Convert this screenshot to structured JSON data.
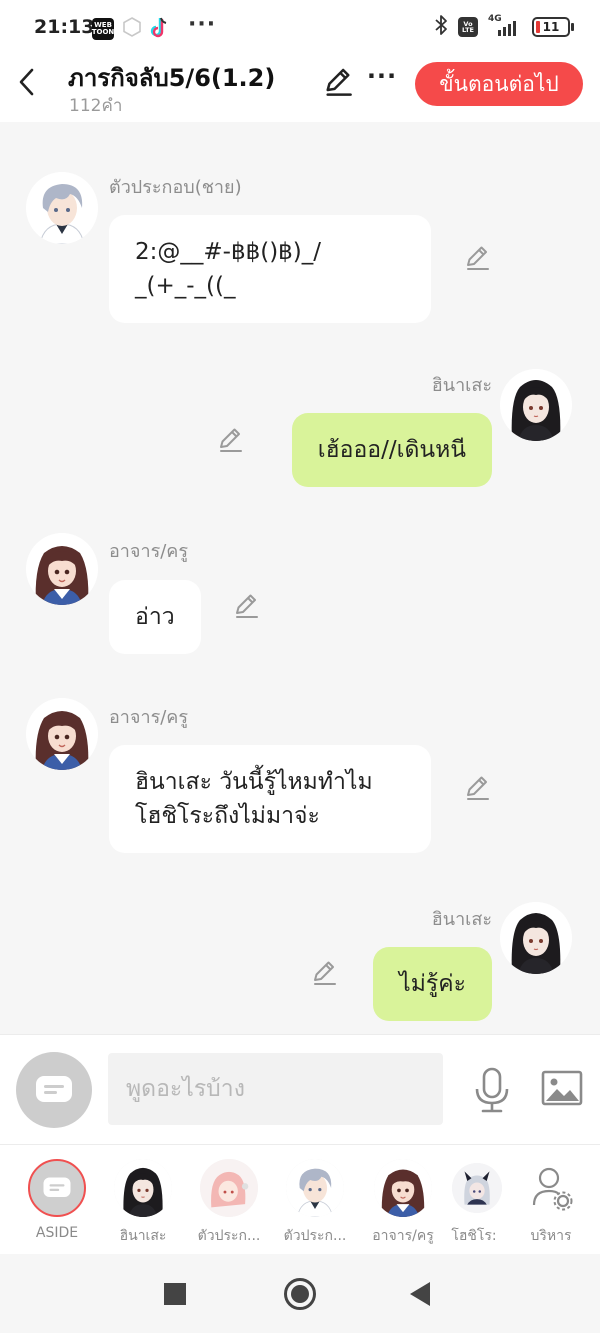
{
  "status_bar": {
    "time": "21:13",
    "app_icons": [
      "webtoon-icon",
      "hexagon-icon",
      "tiktok-icon"
    ],
    "webtoon_label": "WEB\nTOON",
    "overflow": "···",
    "network": "4G",
    "volte": "Vo\nLTE",
    "battery": "11"
  },
  "header": {
    "title": "ภารกิจลับ5/6(1.2)",
    "subtitle": "112คำ",
    "more": "···",
    "next_button": "ขั้นตอนต่อไป"
  },
  "messages": [
    {
      "side": "left",
      "sender": "ตัวประกอบ(ชาย)",
      "avatar": "male-silver-hair-avatar",
      "text": "2:@__#-฿฿()฿)_/\n_(+_-_((_"
    },
    {
      "side": "right",
      "sender": "ฮินาเสะ",
      "avatar": "hinase-avatar",
      "text": "เฮ้อออ//เดินหนี"
    },
    {
      "side": "left",
      "sender": "อาจาร/ครู",
      "avatar": "teacher-avatar",
      "text": "อ่าว"
    },
    {
      "side": "left",
      "sender": "อาจาร/ครู",
      "avatar": "teacher-avatar",
      "text": "ฮินาเสะ วันนี้รู้ไหมทำไม\nโฮชิโระถึงไม่มาจ่ะ"
    },
    {
      "side": "right",
      "sender": "ฮินาเสะ",
      "avatar": "hinase-avatar",
      "text": "ไม่รู้ค่ะ"
    }
  ],
  "input": {
    "placeholder": "พูดอะไรบ้าง"
  },
  "characters": [
    {
      "label": "ASIDE",
      "avatar": "aside-icon"
    },
    {
      "label": "ฮินาเสะ",
      "avatar": "hinase-avatar"
    },
    {
      "label": "ตัวประก...",
      "avatar": "pink-hair-avatar"
    },
    {
      "label": "ตัวประก...",
      "avatar": "male-silver-hair-avatar"
    },
    {
      "label": "อาจาร/ครู",
      "avatar": "teacher-avatar"
    },
    {
      "label": "โฮชิโร:",
      "avatar": "hoshiro-avatar"
    },
    {
      "label": "บริหาร",
      "avatar": "manage-characters-icon"
    }
  ],
  "colors": {
    "accent": "#f54a4a",
    "own_bubble": "#d9f39a",
    "other_bubble": "#ffffff",
    "background": "#f6f6f6"
  }
}
